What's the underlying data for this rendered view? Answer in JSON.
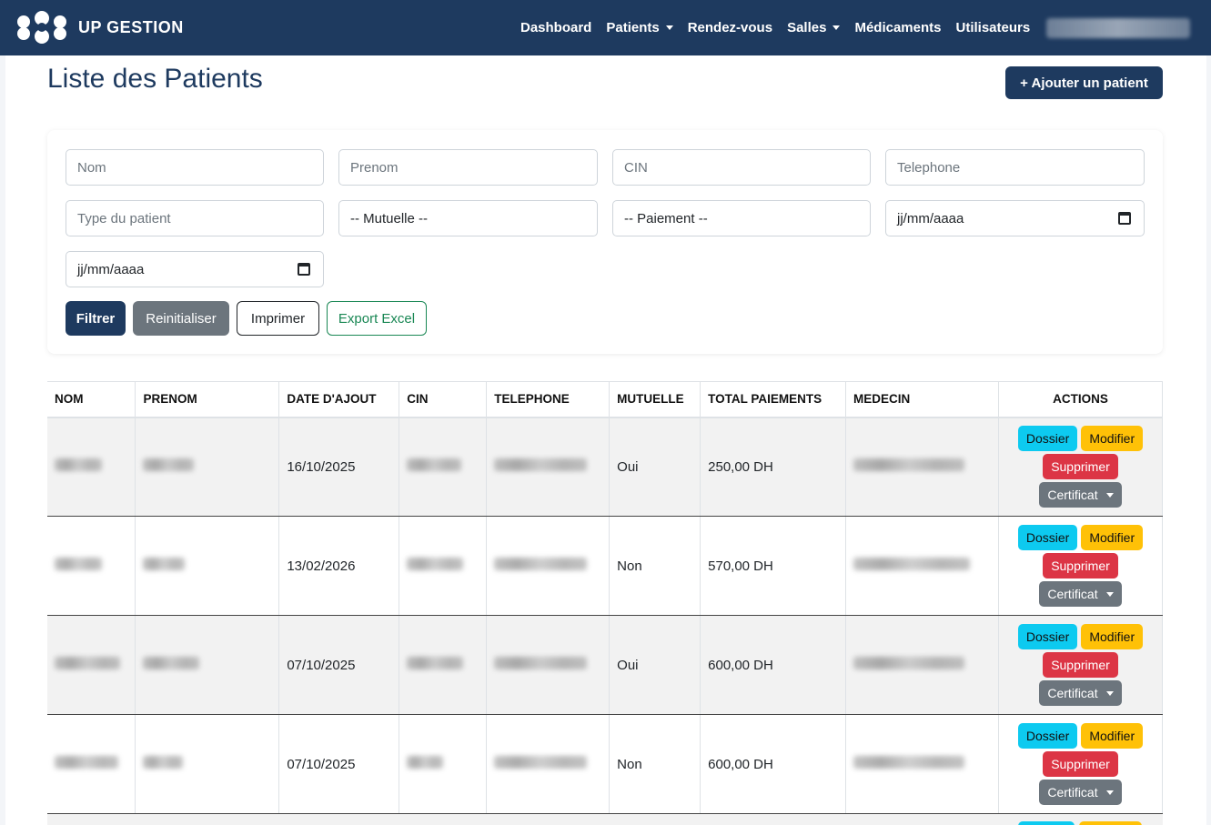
{
  "app": {
    "brand": "UP GESTION"
  },
  "nav": {
    "items": [
      {
        "label": "Dashboard",
        "dropdown": false
      },
      {
        "label": "Patients",
        "dropdown": true
      },
      {
        "label": "Rendez-vous",
        "dropdown": false
      },
      {
        "label": "Salles",
        "dropdown": true
      },
      {
        "label": "Médicaments",
        "dropdown": false
      },
      {
        "label": "Utilisateurs",
        "dropdown": false
      }
    ]
  },
  "header": {
    "title": "Liste des Patients",
    "add_label": "+ Ajouter un patient"
  },
  "filters": {
    "nom_placeholder": "Nom",
    "prenom_placeholder": "Prenom",
    "cin_placeholder": "CIN",
    "telephone_placeholder": "Telephone",
    "type_placeholder": "Type du patient",
    "mutuelle_value": "-- Mutuelle --",
    "paiement_value": "-- Paiement --",
    "date_from_value": "jj/mm/aaaa",
    "date_to_value": "jj/mm/aaaa",
    "btn_filtrer": "Filtrer",
    "btn_reset": "Reinitialiser",
    "btn_print": "Imprimer",
    "btn_excel": "Export Excel"
  },
  "table": {
    "columns": [
      "NOM",
      "PRENOM",
      "DATE D'AJOUT",
      "CIN",
      "TELEPHONE",
      "MUTUELLE",
      "TOTAL PAIEMENTS",
      "MEDECIN",
      "ACTIONS"
    ],
    "actions": {
      "dossier": "Dossier",
      "modifier": "Modifier",
      "supprimer": "Supprimer",
      "certificat": "Certificat"
    },
    "rows": [
      {
        "date": "16/10/2025",
        "mutuelle": "Oui",
        "total": "250,00 DH"
      },
      {
        "date": "13/02/2026",
        "mutuelle": "Non",
        "total": "570,00 DH"
      },
      {
        "date": "07/10/2025",
        "mutuelle": "Oui",
        "total": "600,00 DH"
      },
      {
        "date": "07/10/2025",
        "mutuelle": "Non",
        "total": "600,00 DH"
      }
    ]
  },
  "colors": {
    "primary": "#1e3a5f",
    "info": "#0dcaf0",
    "warning": "#ffc107",
    "danger": "#dc3545",
    "secondary": "#6c757d",
    "success": "#198754"
  }
}
